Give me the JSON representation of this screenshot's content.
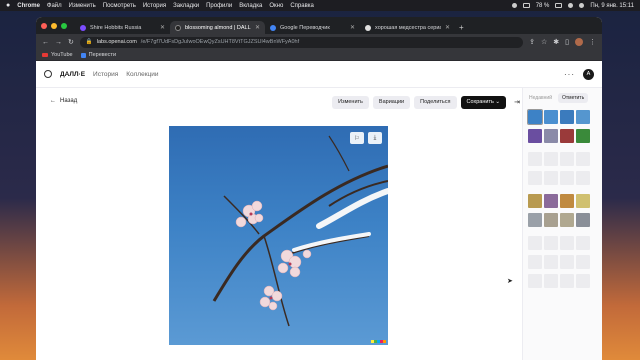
{
  "menubar": {
    "app": "Chrome",
    "items": [
      "Файл",
      "Изменить",
      "Посмотреть",
      "История",
      "Закладки",
      "Профили",
      "Вкладка",
      "Окно",
      "Справка"
    ],
    "battery": "78 %",
    "datetime": "Пн, 9 янв.  15:11"
  },
  "tabs": [
    {
      "title": "Shire Hobbits Russia",
      "color": "#7c4dff"
    },
    {
      "title": "blossoming almond | DALL·E",
      "color": "#222222"
    },
    {
      "title": "Google Переводчик",
      "color": "#4285f4"
    },
    {
      "title": "хорошая медсестра сериал",
      "color": "#e0e0e0"
    }
  ],
  "address": {
    "host": "labs.openai.com",
    "path": "/e/F7gf7UdFsDgJuIwoOEwQyZsUHT8VtTGJZSUl4wBnWFyA0hf"
  },
  "bookmarks": [
    {
      "label": "YouTube",
      "icon": "youtube-icon"
    },
    {
      "label": "Перевести",
      "icon": "translate-icon"
    }
  ],
  "app": {
    "brand": "ДАЛЛ·E",
    "nav": [
      "История",
      "Коллекции"
    ],
    "user_initial": "A"
  },
  "main": {
    "back": "Назад",
    "actions": {
      "edit": "Изменить",
      "variations": "Вариации",
      "share": "Поделиться",
      "save": "Сохранить"
    }
  },
  "sidebar": {
    "tabs": [
      "Недавний",
      "Отметить"
    ]
  }
}
